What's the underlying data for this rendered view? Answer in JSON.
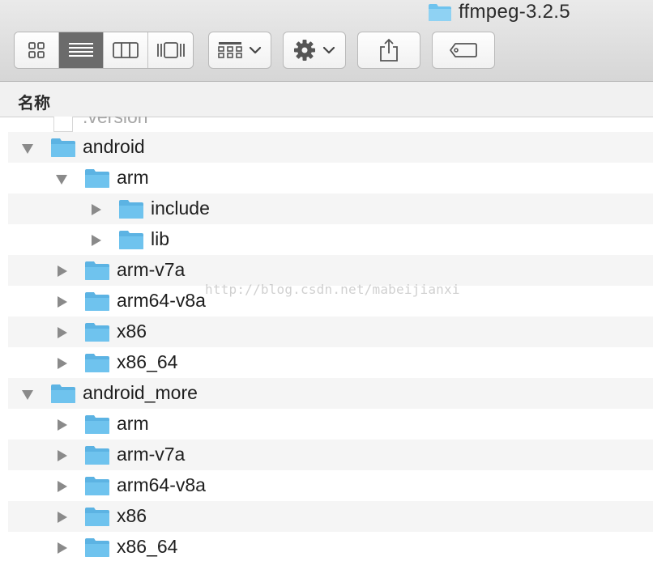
{
  "window": {
    "title": "ffmpeg-3.2.5"
  },
  "toolbar": {
    "view_modes": [
      {
        "name": "icon-view",
        "active": false
      },
      {
        "name": "list-view",
        "active": true
      },
      {
        "name": "column-view",
        "active": false
      },
      {
        "name": "coverflow-view",
        "active": false
      }
    ],
    "buttons": [
      "arrange-menu",
      "action-gear-menu",
      "share",
      "tags"
    ]
  },
  "list_header": {
    "name_column": "名称"
  },
  "rows": [
    {
      "label": ".version",
      "depth": 0,
      "kind": "file",
      "expanded": null,
      "partial": true
    },
    {
      "label": "android",
      "depth": 0,
      "kind": "folder",
      "expanded": true
    },
    {
      "label": "arm",
      "depth": 1,
      "kind": "folder",
      "expanded": true
    },
    {
      "label": "include",
      "depth": 2,
      "kind": "folder",
      "expanded": false
    },
    {
      "label": "lib",
      "depth": 2,
      "kind": "folder",
      "expanded": false
    },
    {
      "label": "arm-v7a",
      "depth": 1,
      "kind": "folder",
      "expanded": false
    },
    {
      "label": "arm64-v8a",
      "depth": 1,
      "kind": "folder",
      "expanded": false
    },
    {
      "label": "x86",
      "depth": 1,
      "kind": "folder",
      "expanded": false
    },
    {
      "label": "x86_64",
      "depth": 1,
      "kind": "folder",
      "expanded": false
    },
    {
      "label": "android_more",
      "depth": 0,
      "kind": "folder",
      "expanded": true
    },
    {
      "label": "arm",
      "depth": 1,
      "kind": "folder",
      "expanded": false
    },
    {
      "label": "arm-v7a",
      "depth": 1,
      "kind": "folder",
      "expanded": false
    },
    {
      "label": "arm64-v8a",
      "depth": 1,
      "kind": "folder",
      "expanded": false
    },
    {
      "label": "x86",
      "depth": 1,
      "kind": "folder",
      "expanded": false
    },
    {
      "label": "x86_64",
      "depth": 1,
      "kind": "folder",
      "expanded": false
    }
  ],
  "watermark": "http://blog.csdn.net/mabeijianxi",
  "colors": {
    "folder": "#6fc3ee",
    "folder_tab": "#5cb3e3",
    "row_alt": "#f5f5f5",
    "disclosure": "#8a8a8a"
  }
}
